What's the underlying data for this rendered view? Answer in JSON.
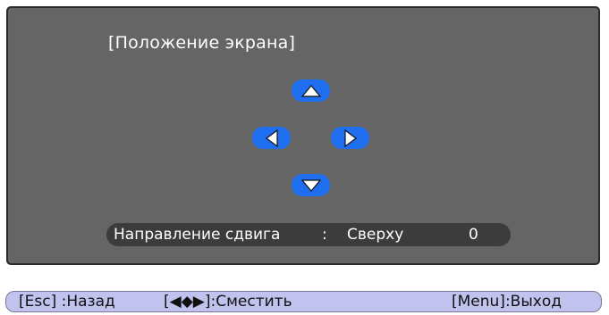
{
  "panel": {
    "title": "[Положение экрана]",
    "arrows": {
      "up": "arrow-up-icon",
      "left": "arrow-left-icon",
      "right": "arrow-right-icon",
      "down": "arrow-down-icon"
    },
    "status": {
      "label": "Направление сдвига",
      "separator": ":",
      "value": "Сверху",
      "number": "0"
    }
  },
  "footer": {
    "back": "[Esc] :Назад",
    "move": "[◀◆▶]:Сместить",
    "exit": "[Menu]:Выход"
  },
  "colors": {
    "panel_bg": "#656565",
    "button_blue": "#1f6ef0",
    "status_bg": "#3c3c3c",
    "footer_bg": "#c2c2ee"
  }
}
